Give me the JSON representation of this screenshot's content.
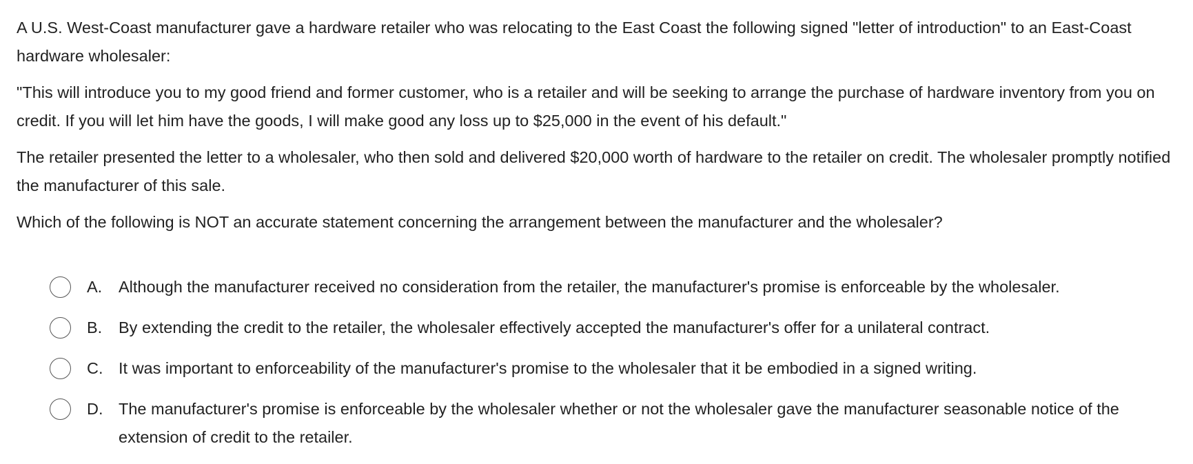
{
  "question": {
    "paragraphs": [
      "A U.S. West-Coast manufacturer gave a hardware retailer who was relocating to the East Coast the following signed \"letter of introduction\" to an East-Coast hardware wholesaler:",
      "\"This will introduce you to my good friend and former customer, who is a retailer and will be seeking to arrange the purchase of hardware inventory from you on credit.  If you will let him have the goods, I will make good any loss up to $25,000 in the event of his default.\"",
      "The retailer presented the letter to a wholesaler, who then sold and delivered $20,000 worth of hardware to the retailer on credit.  The wholesaler promptly notified the manufacturer of this sale.",
      "Which of the following is NOT an accurate statement concerning the arrangement between the manufacturer and the wholesaler?"
    ]
  },
  "options": [
    {
      "letter": "A.",
      "text": "Although the manufacturer received no consideration from the retailer, the manufacturer's promise is enforceable by the wholesaler."
    },
    {
      "letter": "B.",
      "text": "By extending the credit to the retailer, the wholesaler effectively accepted the manufacturer's offer for a unilateral contract."
    },
    {
      "letter": "C.",
      "text": "It was important to enforceability of the manufacturer's promise to the wholesaler that it be embodied in a signed writing."
    },
    {
      "letter": "D.",
      "text": "The manufacturer's promise is enforceable by the wholesaler whether or not the wholesaler gave the manufacturer seasonable notice of the extension of credit to the retailer."
    }
  ]
}
